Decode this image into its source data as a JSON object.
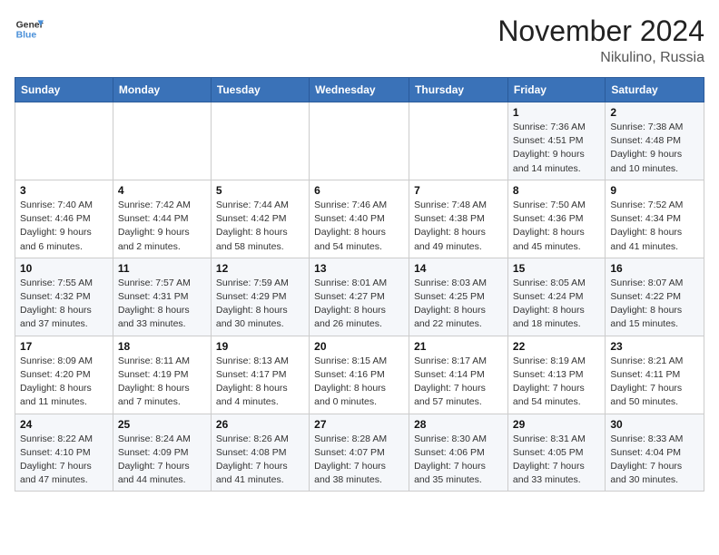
{
  "header": {
    "logo_line1": "General",
    "logo_line2": "Blue",
    "month_title": "November 2024",
    "location": "Nikulino, Russia"
  },
  "weekdays": [
    "Sunday",
    "Monday",
    "Tuesday",
    "Wednesday",
    "Thursday",
    "Friday",
    "Saturday"
  ],
  "weeks": [
    [
      {
        "day": "",
        "info": ""
      },
      {
        "day": "",
        "info": ""
      },
      {
        "day": "",
        "info": ""
      },
      {
        "day": "",
        "info": ""
      },
      {
        "day": "",
        "info": ""
      },
      {
        "day": "1",
        "info": "Sunrise: 7:36 AM\nSunset: 4:51 PM\nDaylight: 9 hours and 14 minutes."
      },
      {
        "day": "2",
        "info": "Sunrise: 7:38 AM\nSunset: 4:48 PM\nDaylight: 9 hours and 10 minutes."
      }
    ],
    [
      {
        "day": "3",
        "info": "Sunrise: 7:40 AM\nSunset: 4:46 PM\nDaylight: 9 hours and 6 minutes."
      },
      {
        "day": "4",
        "info": "Sunrise: 7:42 AM\nSunset: 4:44 PM\nDaylight: 9 hours and 2 minutes."
      },
      {
        "day": "5",
        "info": "Sunrise: 7:44 AM\nSunset: 4:42 PM\nDaylight: 8 hours and 58 minutes."
      },
      {
        "day": "6",
        "info": "Sunrise: 7:46 AM\nSunset: 4:40 PM\nDaylight: 8 hours and 54 minutes."
      },
      {
        "day": "7",
        "info": "Sunrise: 7:48 AM\nSunset: 4:38 PM\nDaylight: 8 hours and 49 minutes."
      },
      {
        "day": "8",
        "info": "Sunrise: 7:50 AM\nSunset: 4:36 PM\nDaylight: 8 hours and 45 minutes."
      },
      {
        "day": "9",
        "info": "Sunrise: 7:52 AM\nSunset: 4:34 PM\nDaylight: 8 hours and 41 minutes."
      }
    ],
    [
      {
        "day": "10",
        "info": "Sunrise: 7:55 AM\nSunset: 4:32 PM\nDaylight: 8 hours and 37 minutes."
      },
      {
        "day": "11",
        "info": "Sunrise: 7:57 AM\nSunset: 4:31 PM\nDaylight: 8 hours and 33 minutes."
      },
      {
        "day": "12",
        "info": "Sunrise: 7:59 AM\nSunset: 4:29 PM\nDaylight: 8 hours and 30 minutes."
      },
      {
        "day": "13",
        "info": "Sunrise: 8:01 AM\nSunset: 4:27 PM\nDaylight: 8 hours and 26 minutes."
      },
      {
        "day": "14",
        "info": "Sunrise: 8:03 AM\nSunset: 4:25 PM\nDaylight: 8 hours and 22 minutes."
      },
      {
        "day": "15",
        "info": "Sunrise: 8:05 AM\nSunset: 4:24 PM\nDaylight: 8 hours and 18 minutes."
      },
      {
        "day": "16",
        "info": "Sunrise: 8:07 AM\nSunset: 4:22 PM\nDaylight: 8 hours and 15 minutes."
      }
    ],
    [
      {
        "day": "17",
        "info": "Sunrise: 8:09 AM\nSunset: 4:20 PM\nDaylight: 8 hours and 11 minutes."
      },
      {
        "day": "18",
        "info": "Sunrise: 8:11 AM\nSunset: 4:19 PM\nDaylight: 8 hours and 7 minutes."
      },
      {
        "day": "19",
        "info": "Sunrise: 8:13 AM\nSunset: 4:17 PM\nDaylight: 8 hours and 4 minutes."
      },
      {
        "day": "20",
        "info": "Sunrise: 8:15 AM\nSunset: 4:16 PM\nDaylight: 8 hours and 0 minutes."
      },
      {
        "day": "21",
        "info": "Sunrise: 8:17 AM\nSunset: 4:14 PM\nDaylight: 7 hours and 57 minutes."
      },
      {
        "day": "22",
        "info": "Sunrise: 8:19 AM\nSunset: 4:13 PM\nDaylight: 7 hours and 54 minutes."
      },
      {
        "day": "23",
        "info": "Sunrise: 8:21 AM\nSunset: 4:11 PM\nDaylight: 7 hours and 50 minutes."
      }
    ],
    [
      {
        "day": "24",
        "info": "Sunrise: 8:22 AM\nSunset: 4:10 PM\nDaylight: 7 hours and 47 minutes."
      },
      {
        "day": "25",
        "info": "Sunrise: 8:24 AM\nSunset: 4:09 PM\nDaylight: 7 hours and 44 minutes."
      },
      {
        "day": "26",
        "info": "Sunrise: 8:26 AM\nSunset: 4:08 PM\nDaylight: 7 hours and 41 minutes."
      },
      {
        "day": "27",
        "info": "Sunrise: 8:28 AM\nSunset: 4:07 PM\nDaylight: 7 hours and 38 minutes."
      },
      {
        "day": "28",
        "info": "Sunrise: 8:30 AM\nSunset: 4:06 PM\nDaylight: 7 hours and 35 minutes."
      },
      {
        "day": "29",
        "info": "Sunrise: 8:31 AM\nSunset: 4:05 PM\nDaylight: 7 hours and 33 minutes."
      },
      {
        "day": "30",
        "info": "Sunrise: 8:33 AM\nSunset: 4:04 PM\nDaylight: 7 hours and 30 minutes."
      }
    ]
  ]
}
